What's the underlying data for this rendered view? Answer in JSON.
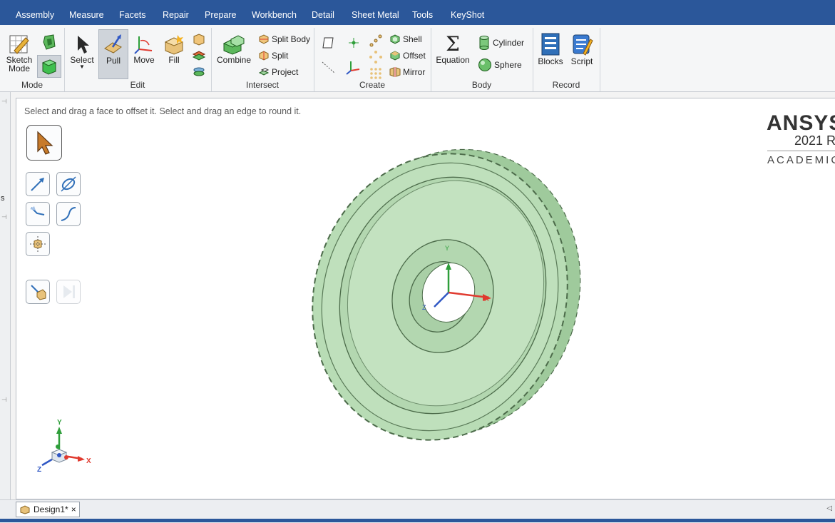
{
  "menu": [
    "Assembly",
    "Measure",
    "Facets",
    "Repair",
    "Prepare",
    "Workbench",
    "Detail",
    "Sheet Metal",
    "Tools",
    "KeyShot"
  ],
  "ribbon": {
    "mode": {
      "label": "Mode",
      "sketch_line1": "Sketch",
      "sketch_line2": "Mode"
    },
    "edit": {
      "label": "Edit",
      "select": "Select",
      "pull": "Pull",
      "move": "Move",
      "fill": "Fill"
    },
    "intersect": {
      "label": "Intersect",
      "combine": "Combine",
      "split_body": "Split Body",
      "split": "Split",
      "project": "Project"
    },
    "create": {
      "label": "Create",
      "shell": "Shell",
      "offset": "Offset",
      "mirror": "Mirror"
    },
    "body": {
      "label": "Body",
      "equation": "Equation",
      "cylinder": "Cylinder",
      "sphere": "Sphere"
    },
    "record": {
      "label": "Record",
      "blocks": "Blocks",
      "script": "Script"
    }
  },
  "canvas": {
    "hint": "Select and drag a face to offset it. Select and drag an edge to round it."
  },
  "logo": {
    "brand": "ANSYS",
    "version": "2021 R",
    "edition": "ACADEMIC"
  },
  "triad": {
    "x": "X",
    "y": "Y",
    "z": "Z"
  },
  "doc_tab": {
    "label": "Design1*",
    "close": "×"
  },
  "left_pin_labels": [
    "s"
  ],
  "colors": {
    "menubar": "#2b579a",
    "gear": "#b5d9b3",
    "gear_dark": "#8fbf8c",
    "accent_red": "#e03a2f",
    "accent_green": "#2e9e3a",
    "accent_blue": "#2f57c4"
  }
}
